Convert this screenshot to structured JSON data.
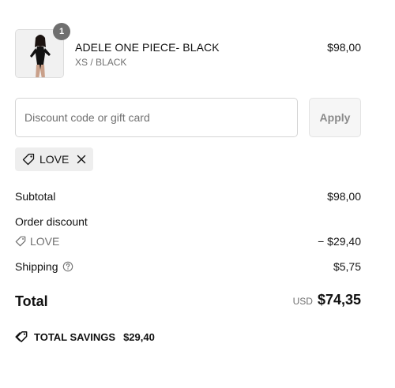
{
  "cart": {
    "item": {
      "quantity": "1",
      "name": "ADELE ONE PIECE- BLACK",
      "variant": "XS / BLACK",
      "price": "$98,00"
    }
  },
  "discount": {
    "placeholder": "Discount code or gift card",
    "value": "",
    "apply_label": "Apply",
    "applied_code": "LOVE"
  },
  "summary": {
    "subtotal_label": "Subtotal",
    "subtotal_value": "$98,00",
    "order_discount_label": "Order discount",
    "discount_code": "LOVE",
    "discount_value": "− $29,40",
    "shipping_label": "Shipping",
    "shipping_value": "$5,75",
    "total_label": "Total",
    "currency": "USD",
    "total_value": "$74,35",
    "savings_label": "TOTAL SAVINGS",
    "savings_value": "$29,40"
  },
  "icons": {
    "tag": "tag-icon",
    "remove": "close-icon",
    "info": "question-circle-icon",
    "savings": "tag-icon"
  },
  "colors": {
    "muted_text": "#707070",
    "badge_bg": "#6f6f6f",
    "tag_bg": "#eeeeee"
  }
}
